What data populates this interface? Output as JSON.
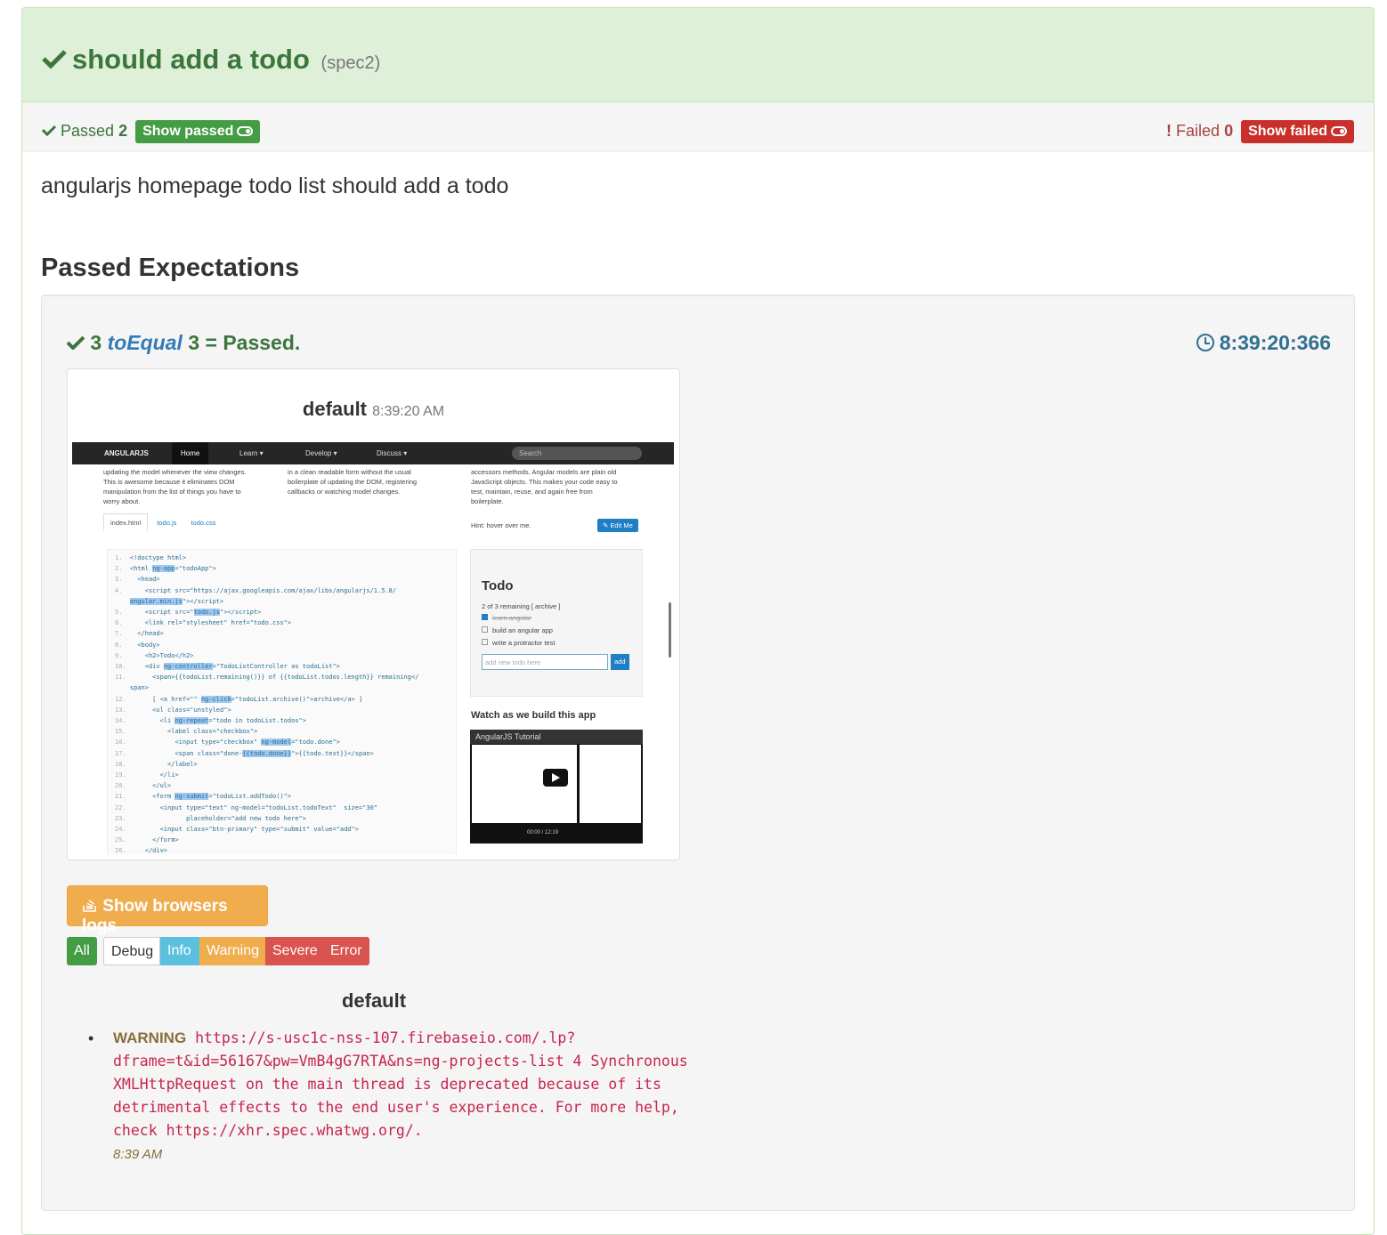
{
  "spec": {
    "title": "should add a todo",
    "id": "(spec2)",
    "description": "angularjs homepage todo list should add a todo"
  },
  "summary": {
    "passed_label": "Passed",
    "passed_count": "2",
    "show_passed_label": "Show passed",
    "failed_label": "Failed",
    "failed_count": "0",
    "show_failed_label": "Show failed"
  },
  "section": {
    "title": "Passed Expectations"
  },
  "expectation": {
    "actual": "3",
    "matcher": "toEqual",
    "expected": "3",
    "result": "= Passed.",
    "time": "8:39:20:366"
  },
  "screenshot": {
    "browser": "default",
    "time": "8:39:20 AM",
    "nav": {
      "logo": "ANGULARJS",
      "home": "Home",
      "learn": "Learn ▾",
      "develop": "Develop ▾",
      "discuss": "Discuss ▾",
      "search": "Search"
    },
    "col1": "updating the model whenever the view changes.\nThis is awesome because it eliminates DOM\nmanipulation from the list of things you have to\nworry about.",
    "col2": "in a clean readable form without the usual\nboilerplate of updating the DOM, registering\ncallbacks or watching model changes.",
    "col3": "accessors methods. Angular models are plain old\nJavaScript objects. This makes your code easy to\ntest, maintain, reuse, and again free from\nboilerplate.",
    "tabs": [
      "index.html",
      "todo.js",
      "todo.css"
    ],
    "hint": "Hint: hover over me.",
    "edit": "✎ Edit Me",
    "todo_title": "Todo",
    "todo_remaining": "2 of 3 remaining [ archive ]",
    "todo_items": [
      "learn angular",
      "build an angular app",
      "write a protractor test"
    ],
    "todo_placeholder": "add new todo here",
    "todo_add": "add",
    "watch": "Watch as we build this app",
    "video_title": "AngularJS Tutorial",
    "video_time": "00:00 / 12:19"
  },
  "logs": {
    "button_label": "Show browsers logs",
    "filters": [
      "All",
      "Debug",
      "Info",
      "Warning",
      "Severe",
      "Error"
    ],
    "group": "default",
    "entry": {
      "level": "WARNING",
      "message": "https://s-usc1c-nss-107.firebaseio.com/.lp?dframe=t&id=56167&pw=VmB4gG7RTA&ns=ng-projects-list 4 Synchronous XMLHttpRequest on the main thread is deprecated because of its detrimental effects to the end user's experience. For more help, check https://xhr.spec.whatwg.org/.",
      "time": "8:39 AM"
    }
  },
  "colors": {
    "success": "#3c763d",
    "danger": "#a94442",
    "warning": "#f0ad4e",
    "info": "#5bc0de"
  }
}
